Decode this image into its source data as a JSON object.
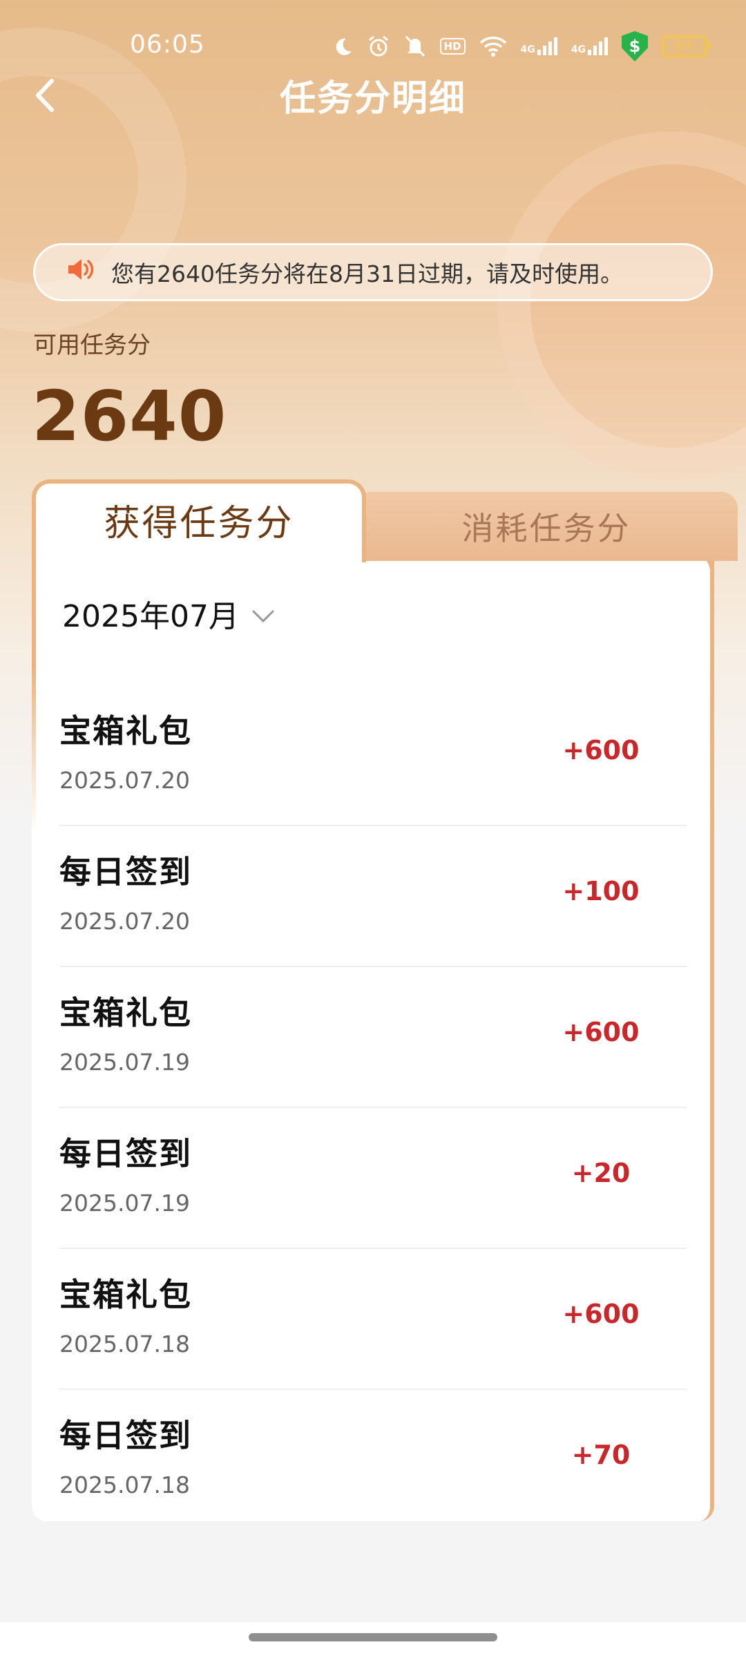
{
  "status_bar": {
    "time": "06:05",
    "hd": "HD",
    "signal1": "4G",
    "signal2": "4G",
    "security_badge": "$",
    "battery": "97"
  },
  "header": {
    "title": "任务分明细",
    "back_icon": "chevron-left-icon"
  },
  "notice": {
    "text": "您有2640任务分将在8月31日过期，请及时使用。",
    "icon": "speaker-icon"
  },
  "balance": {
    "label": "可用任务分",
    "value": "2640"
  },
  "tabs": [
    {
      "label": "获得任务分",
      "active": true
    },
    {
      "label": "消耗任务分",
      "active": false
    }
  ],
  "filter": {
    "month": "2025年07月"
  },
  "records": [
    {
      "title": "宝箱礼包",
      "date": "2025.07.20",
      "points": "+600"
    },
    {
      "title": "每日签到",
      "date": "2025.07.20",
      "points": "+100"
    },
    {
      "title": "宝箱礼包",
      "date": "2025.07.19",
      "points": "+600"
    },
    {
      "title": "每日签到",
      "date": "2025.07.19",
      "points": "+20"
    },
    {
      "title": "宝箱礼包",
      "date": "2025.07.18",
      "points": "+600"
    },
    {
      "title": "每日签到",
      "date": "2025.07.18",
      "points": "+70"
    }
  ],
  "colors": {
    "accent_brown": "#6b3a13",
    "points_red": "#c8282c",
    "tab_border": "#e9b47f"
  }
}
